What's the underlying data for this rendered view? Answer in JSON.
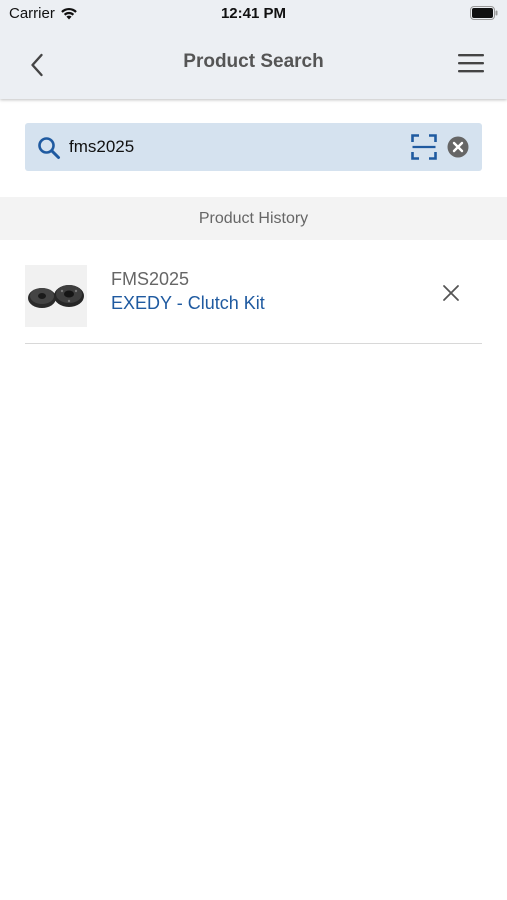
{
  "status_bar": {
    "carrier": "Carrier",
    "time": "12:41 PM"
  },
  "nav": {
    "title": "Product Search",
    "back_icon": "chevron-left-icon",
    "menu_icon": "hamburger-menu-icon"
  },
  "search": {
    "value": "fms2025",
    "icon": "search-icon",
    "scan_icon": "barcode-scan-icon",
    "clear_icon": "clear-circle-icon"
  },
  "history": {
    "header": "Product History",
    "items": [
      {
        "code": "FMS2025",
        "name": "EXEDY - Clutch Kit",
        "thumbnail": "clutch-kit-image",
        "remove_icon": "close-icon"
      }
    ]
  },
  "colors": {
    "header_bg": "#eceff3",
    "search_bg": "#d5e2ef",
    "accent": "#1f5aa0",
    "section_bg": "#f3f3f3"
  }
}
